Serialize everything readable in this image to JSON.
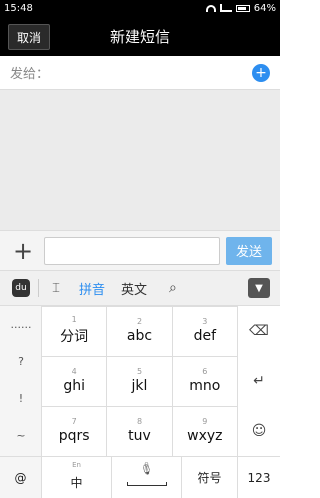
{
  "status": {
    "time": "15:48",
    "battery": "64%"
  },
  "header": {
    "cancel": "取消",
    "title": "新建短信"
  },
  "recipient": {
    "label": "发给："
  },
  "composer": {
    "send": "发送",
    "placeholder": ""
  },
  "ime_toolbar": {
    "logo": "du",
    "pinyin": "拼音",
    "english": "英文"
  },
  "keyboard": {
    "left_keys": [
      "......",
      "?",
      "!",
      "~"
    ],
    "keys": [
      {
        "num": "1",
        "label": "分词"
      },
      {
        "num": "2",
        "label": "abc"
      },
      {
        "num": "3",
        "label": "def"
      },
      {
        "num": "4",
        "label": "ghi"
      },
      {
        "num": "5",
        "label": "jkl"
      },
      {
        "num": "6",
        "label": "mno"
      },
      {
        "num": "7",
        "label": "pqrs"
      },
      {
        "num": "8",
        "label": "tuv"
      },
      {
        "num": "9",
        "label": "wxyz"
      }
    ],
    "bottom": {
      "at": "@",
      "zh_sub": "En",
      "zh": "中",
      "space_num": "0",
      "symbols": "符号",
      "numbers": "123"
    }
  },
  "colors": {
    "accent": "#2d8ef0",
    "send_button": "#6fb4ec",
    "message_area": "#ebebeb"
  }
}
